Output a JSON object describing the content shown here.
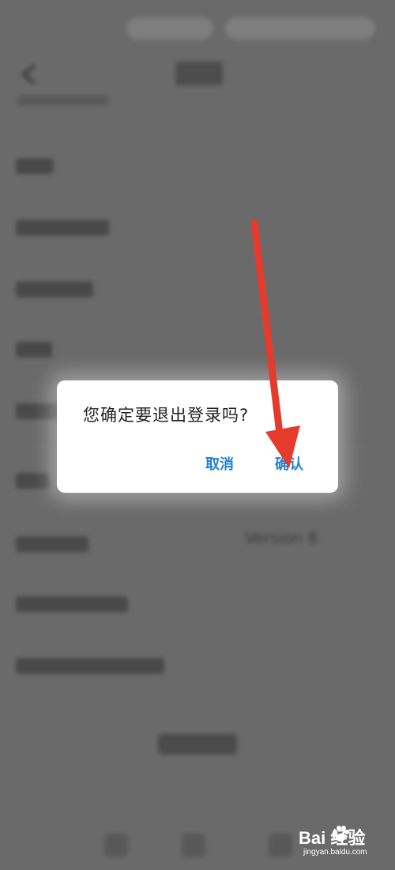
{
  "background_screen": {
    "version_text": "Version 6"
  },
  "dialog": {
    "message": "您确定要退出登录吗?",
    "cancel_label": "取消",
    "confirm_label": "确认",
    "button_color": "#1e7fd6"
  },
  "annotation": {
    "arrow_color": "#e53b2c",
    "arrow_target": "confirm-button"
  },
  "watermark": {
    "brand": "Bai  经验",
    "url": "jingyan.baidu.com"
  }
}
